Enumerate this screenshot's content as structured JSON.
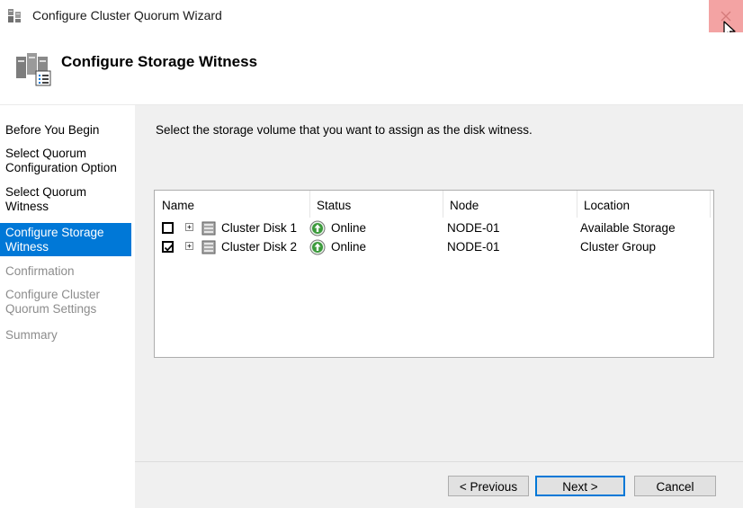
{
  "window": {
    "title": "Configure Cluster Quorum Wizard"
  },
  "header": {
    "title": "Configure Storage Witness"
  },
  "sidebar": {
    "steps": [
      {
        "label": "Before You Begin",
        "state": "completed"
      },
      {
        "label": "Select Quorum Configuration Option",
        "state": "completed"
      },
      {
        "label": "Select Quorum Witness",
        "state": "completed"
      },
      {
        "label": "Configure Storage Witness",
        "state": "active"
      },
      {
        "label": "Confirmation",
        "state": "disabled"
      },
      {
        "label": "Configure Cluster Quorum Settings",
        "state": "disabled"
      },
      {
        "label": "Summary",
        "state": "disabled"
      }
    ]
  },
  "main": {
    "instruction": "Select the storage volume that you want to assign as the disk witness.",
    "columns": [
      "Name",
      "Status",
      "Node",
      "Location"
    ],
    "rows": [
      {
        "checked": false,
        "name": "Cluster Disk 1",
        "status": "Online",
        "node": "NODE-01",
        "location": "Available Storage"
      },
      {
        "checked": true,
        "name": "Cluster Disk 2",
        "status": "Online",
        "node": "NODE-01",
        "location": "Cluster Group"
      }
    ]
  },
  "footer": {
    "previous_label": "< Previous",
    "next_label": "Next >",
    "cancel_label": "Cancel"
  },
  "colors": {
    "accent": "#0078d7",
    "close_hover": "#f3a3a3",
    "online": "#3c9a3c"
  }
}
